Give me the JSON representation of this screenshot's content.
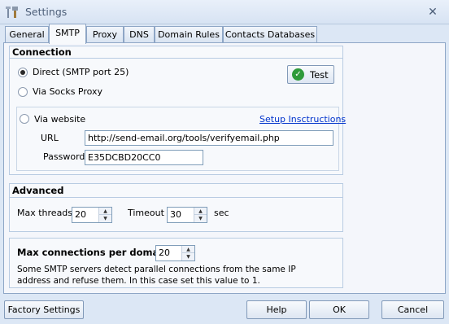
{
  "window": {
    "title": "Settings",
    "close_glyph": "✕"
  },
  "tabs": [
    {
      "label": "General",
      "active": false
    },
    {
      "label": "SMTP",
      "active": true
    },
    {
      "label": "Proxy",
      "active": false
    },
    {
      "label": "DNS",
      "active": false
    },
    {
      "label": "Domain Rules",
      "active": false
    },
    {
      "label": "Contacts Databases",
      "active": false
    }
  ],
  "connection": {
    "title": "Connection",
    "direct_label": "Direct (SMTP port 25)",
    "socks_label": "Via Socks Proxy",
    "website_label": "Via website",
    "selected": "direct",
    "test_button": "Test",
    "setup_link": "Setup Insctructions",
    "url_label": "URL",
    "url_value": "http://send-email.org/tools/verifyemail.php",
    "password_label": "Password",
    "password_value": "E35DCBD20CC0"
  },
  "advanced": {
    "title": "Advanced",
    "max_threads_label": "Max threads",
    "max_threads_value": "20",
    "timeout_label": "Timeout",
    "timeout_value": "30",
    "timeout_unit": "sec"
  },
  "max_connections": {
    "title": "Max connections per domain",
    "value": "20",
    "description_line1": "Some SMTP servers detect parallel connections from the same IP",
    "description_line2": "address  and refuse them. In this case set this value to 1."
  },
  "footer": {
    "factory_settings": "Factory Settings",
    "help": "Help",
    "ok": "OK",
    "cancel": "Cancel"
  },
  "icons": {
    "app": "settings-tools-icon",
    "test": "green-check-icon"
  },
  "colors": {
    "accent_link": "#0033cc",
    "check_green": "#2e9a3a",
    "window_bg": "#dce7f5"
  }
}
